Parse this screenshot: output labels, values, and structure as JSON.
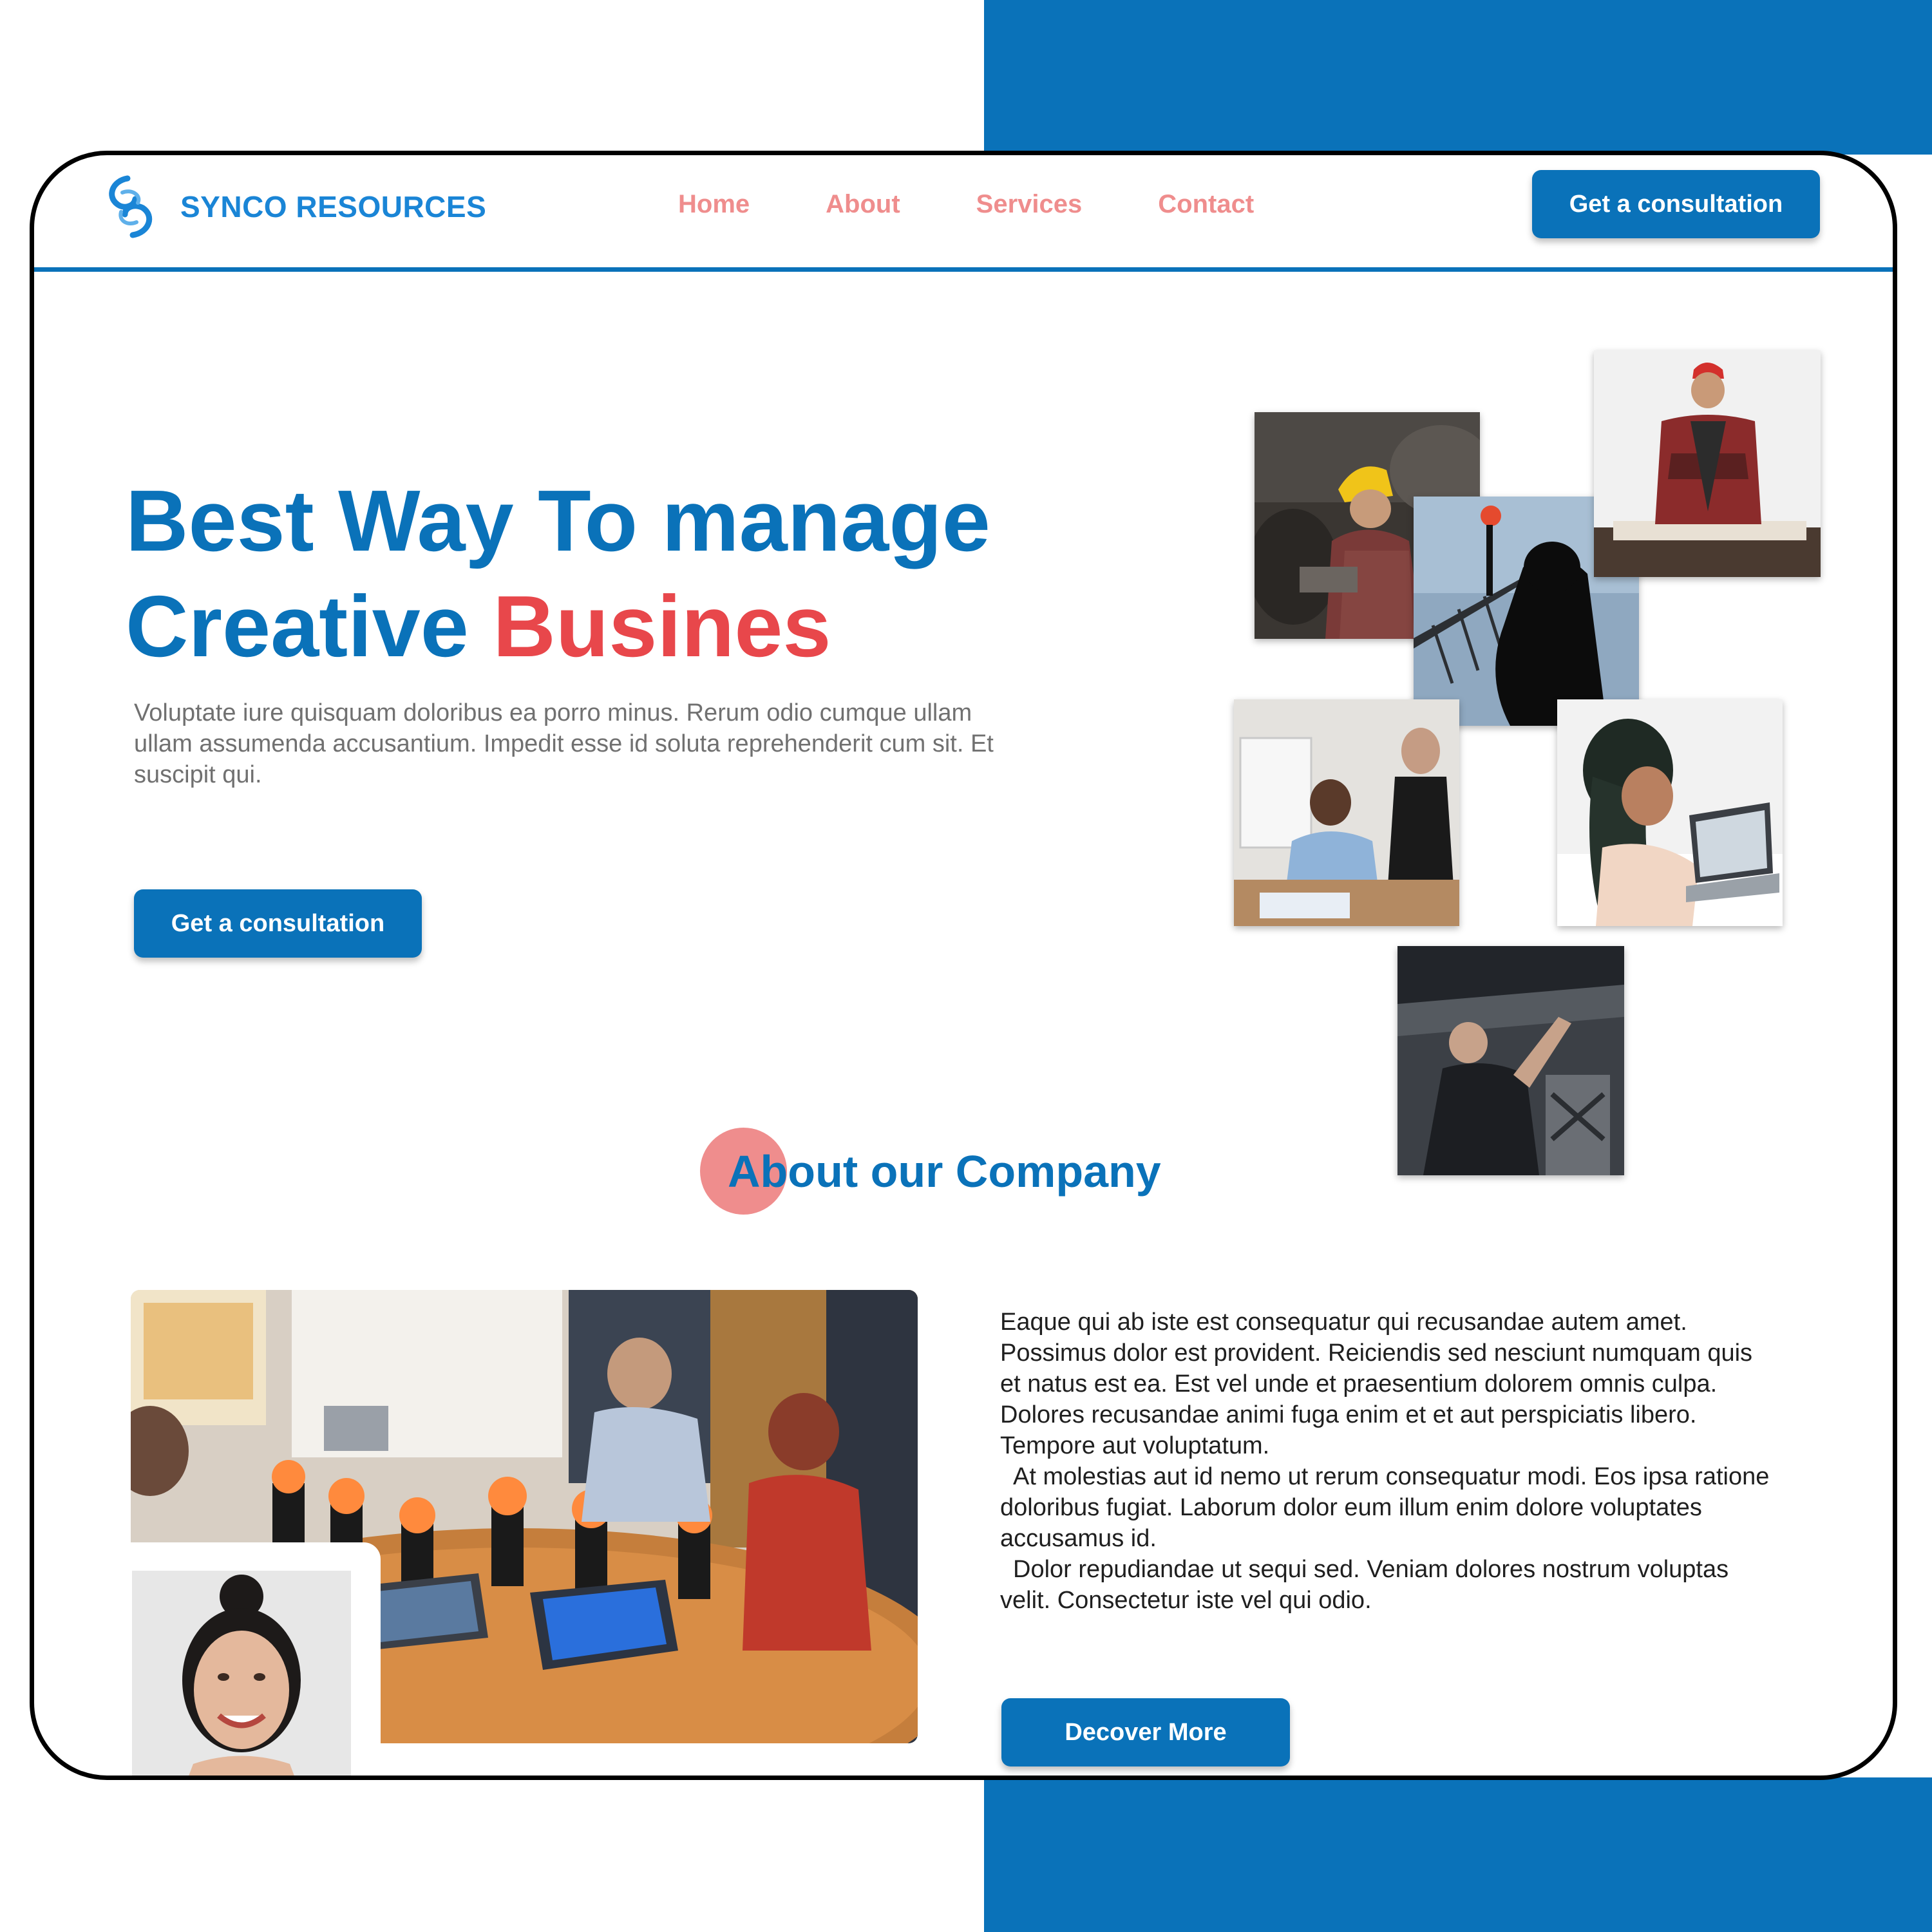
{
  "brand": {
    "name": "SYNCO RESOURCES"
  },
  "nav": {
    "items": [
      "Home",
      "About",
      "Services",
      "Contact"
    ],
    "cta_label": "Get a consultation"
  },
  "hero": {
    "title_line1": "Best Way To manage",
    "title_line2_main": "Creative ",
    "title_line2_accent": "Busines",
    "description": "Voluptate iure quisquam doloribus ea porro minus. Rerum odio cumque ullam ullam assumenda accusantium. Impedit esse id soluta reprehenderit cum sit. Et suscipit qui.",
    "cta_label": "Get a consultation"
  },
  "about": {
    "title": "About our Company",
    "paragraphs": [
      "Eaque qui ab iste est consequatur qui recusandae autem amet. Possimus dolor est provident. Reiciendis sed nesciunt numquam quis et natus est ea. Est vel unde et praesentium dolorem omnis culpa. Dolores recusandae animi fuga enim et et aut perspiciatis libero. Tempore aut voluptatum.",
      "At molestias aut id nemo ut rerum consequatur modi. Eos ipsa ratione doloribus fugiat. Laborum dolor eum illum enim dolore voluptates accusamus id.",
      "Dolor repudiandae ut sequi sed. Veniam dolores nostrum voluptas velit. Consectetur iste vel qui odio."
    ],
    "cta_label": "Decover More"
  },
  "colors": {
    "primary": "#0a72b9",
    "accent_red": "#e8474b",
    "nav_pink": "#ef8d8d",
    "body_gray": "#707070"
  },
  "icons": {
    "logo": "synco-swirl-logo-icon"
  }
}
